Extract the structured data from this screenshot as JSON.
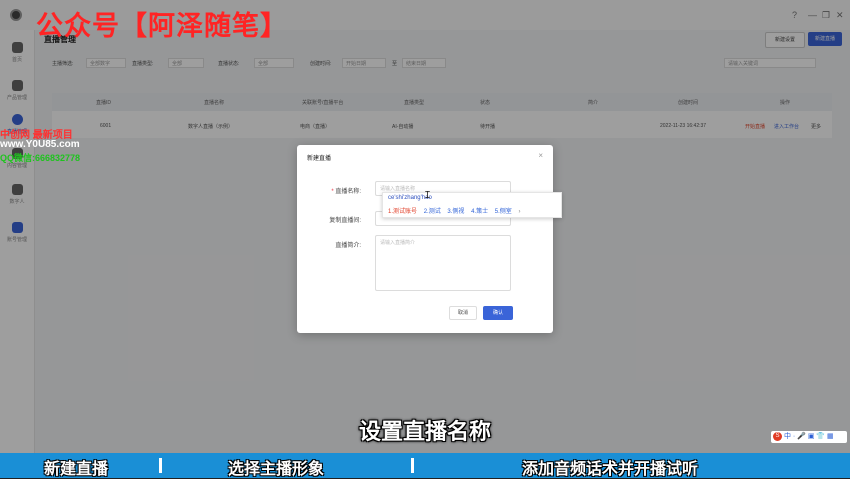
{
  "watermark": {
    "title": "公众号【阿泽随笔】",
    "side_line1": "中创网 最新项目",
    "side_line2": "www.Y0U85.com",
    "side_line3": "QQ微信:666832778"
  },
  "window": {
    "controls": [
      "?",
      "—",
      "❐",
      "✕"
    ]
  },
  "sidebar": {
    "items": [
      {
        "label": "首页",
        "icon": "home-icon"
      },
      {
        "label": "产品管理",
        "icon": "box-icon"
      },
      {
        "label": "直播管理",
        "icon": "live-icon"
      },
      {
        "label": "内容管理",
        "icon": "doc-icon"
      },
      {
        "label": "数字人",
        "icon": "user-icon"
      },
      {
        "label": "账号管理",
        "icon": "account-icon"
      }
    ]
  },
  "page": {
    "title": "直播管理",
    "btn_secondary": "新建设置",
    "btn_primary": "新建直播"
  },
  "filters": {
    "anchor_label": "主播筛选:",
    "anchor_value": "全部数字",
    "type_label": "直播类型:",
    "type_value": "全部",
    "status_label": "直播状态:",
    "status_value": "全部",
    "time_label": "创建时间:",
    "time_start": "开始日期",
    "time_to": "至",
    "time_end": "结束日期",
    "search_placeholder": "请输入关键词"
  },
  "table": {
    "headers": [
      "直播ID",
      "直播名称",
      "关联账号/直播平台",
      "直播类型",
      "状态",
      "简介",
      "创建时间",
      "操作"
    ],
    "row": {
      "id": "6001",
      "name": "数字人直播（示例）",
      "platform": "电商（直播）",
      "type": "AI-自动播",
      "status": "待开播",
      "desc": "",
      "time": "2022-11-23 16:42:37",
      "op1": "开始直播",
      "op2": "进入工作台",
      "op3": "更多"
    }
  },
  "dialog": {
    "title": "新建直播",
    "close": "×",
    "name_label": "直播名称:",
    "name_placeholder": "请输入直播名称",
    "copy_label": "复制直播间:",
    "intro_label": "直播简介:",
    "intro_placeholder": "请输入直播简介",
    "cancel": "取消",
    "ok": "确认"
  },
  "ime": {
    "pinyin": "ce'shi'zhang'hao",
    "candidates": [
      "1.测试账号",
      "2.测试",
      "3.侧视",
      "4.策士",
      "5.侧室"
    ],
    "more": "›"
  },
  "subtitle": "设置直播名称",
  "steps": [
    "新建直播",
    "选择主播形象",
    "添加音频话术并开播试听"
  ],
  "tray": {
    "logo": "S",
    "text": "中 · 🎤 ▣ 👕 ▦"
  }
}
